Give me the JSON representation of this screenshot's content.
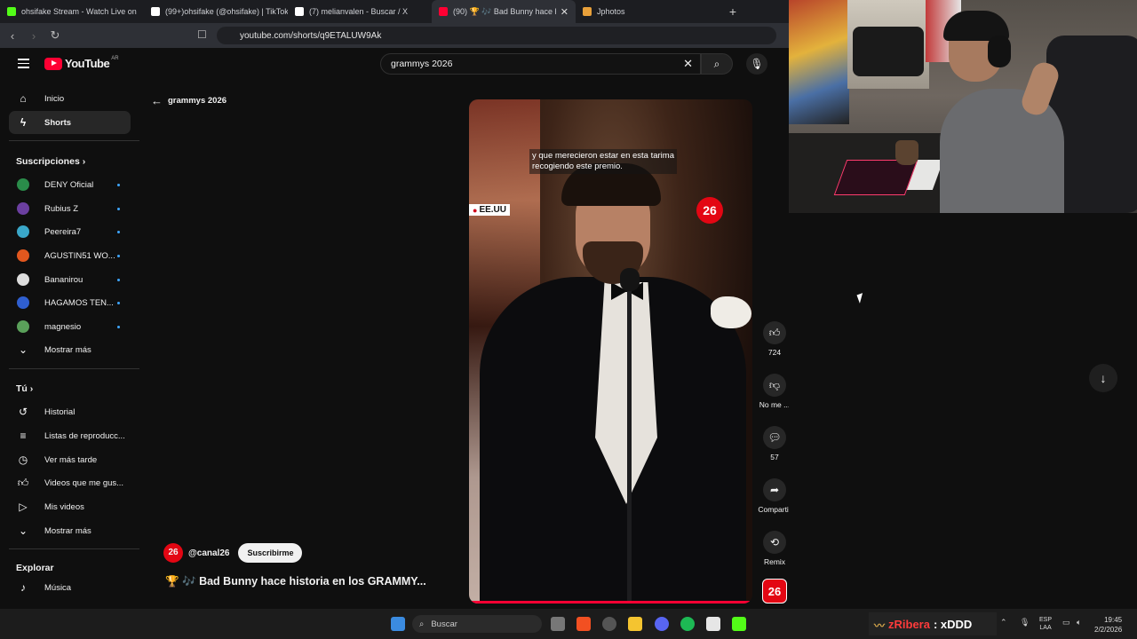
{
  "browser": {
    "tabs": [
      {
        "title": "ohsifake Stream - Watch Live on",
        "color": "#53fc18"
      },
      {
        "title": "(99+)ohsifake (@ohsifake) | TikTok",
        "color": "#111111"
      },
      {
        "title": "(7) melianvalen - Buscar / X",
        "color": "#000000"
      },
      {
        "title": "(90) 🏆 🎶 Bad Bunny hace histo",
        "color": "#ff0033"
      },
      {
        "title": "Jphotos",
        "color": "#e8a03a"
      }
    ],
    "new_tab": "+",
    "url": "youtube.com/shorts/q9ETALUW9Ak"
  },
  "youtube": {
    "country": "AR",
    "logo": "YouTube",
    "search_value": "grammys 2026",
    "back_label": "grammys 2026",
    "nav": [
      {
        "label": "Inicio",
        "icon": "home-icon"
      },
      {
        "label": "Shorts",
        "icon": "shorts-icon"
      }
    ],
    "subscriptions_title": "Suscripciones",
    "subscriptions": [
      {
        "label": "DENY Oficial",
        "color": "#2a8c4a"
      },
      {
        "label": "Rubius Z",
        "color": "#6b3fa0"
      },
      {
        "label": "Peereira7",
        "color": "#3aa7c9"
      },
      {
        "label": "AGUSTIN51 WO...",
        "color": "#e2571e"
      },
      {
        "label": "Bananirou",
        "color": "#dddddd"
      },
      {
        "label": "HAGAMOS TEN...",
        "color": "#2f5fd0"
      },
      {
        "label": "magnesio",
        "color": "#5aa05a"
      }
    ],
    "show_more": "Mostrar más",
    "you_title": "Tú",
    "you_items": [
      {
        "label": "Historial",
        "icon": "history-icon"
      },
      {
        "label": "Listas de reproducc...",
        "icon": "playlist-icon"
      },
      {
        "label": "Ver más tarde",
        "icon": "clock-icon"
      },
      {
        "label": "Videos que me gus...",
        "icon": "thumbs-up-icon"
      },
      {
        "label": "Mis videos",
        "icon": "my-videos-icon"
      }
    ],
    "show_more_2": "Mostrar más",
    "explore_title": "Explorar",
    "explore_items": [
      {
        "label": "Música",
        "icon": "music-icon"
      }
    ]
  },
  "short": {
    "caption_line1": "y que merecieron estar en esta tarima",
    "caption_line2": "recogiendo este premio.",
    "location": "EE.UU",
    "channel_badge": "26",
    "channel": "@canal26",
    "subscribe": "Suscribirme",
    "title": "🏆 🎶 Bad Bunny hace historia en los GRAMMY...",
    "likes": "724",
    "dislike_label": "No me ...",
    "comments": "57",
    "share_label": "Compartir",
    "remix_label": "Remix",
    "progress": 1.0
  },
  "taskbar": {
    "search": "Buscar",
    "chat_user": "zRibera",
    "chat_message": ": xDDD",
    "lang_line1": "ESP",
    "lang_line2": "LAA",
    "time": "19:45",
    "date": "2/2/2026"
  }
}
